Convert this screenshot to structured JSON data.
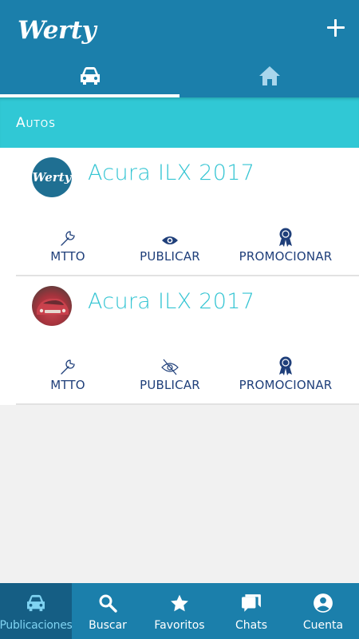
{
  "header": {
    "logo": "Werty",
    "tabs": [
      {
        "icon": "car-icon",
        "active": true
      },
      {
        "icon": "home-icon",
        "active": false
      }
    ]
  },
  "section": {
    "title": "Autos"
  },
  "cards": [
    {
      "avatar_text": "Werty",
      "title": "Acura ILX 2017",
      "actions": [
        {
          "label": "MTTO",
          "icon": "wrench-icon"
        },
        {
          "label": "PUBLICAR",
          "icon": "eye-icon"
        },
        {
          "label": "PROMOCIONAR",
          "icon": "award-ribbon-icon"
        }
      ]
    },
    {
      "avatar_text": "",
      "title": "Acura ILX 2017",
      "actions": [
        {
          "label": "MTTO",
          "icon": "wrench-icon"
        },
        {
          "label": "PUBLICAR",
          "icon": "eye-off-icon"
        },
        {
          "label": "PROMOCIONAR",
          "icon": "award-ribbon-icon"
        }
      ]
    }
  ],
  "bottom_nav": [
    {
      "label": "Publicaciones",
      "icon": "car-icon",
      "active": true
    },
    {
      "label": "Buscar",
      "icon": "search-icon",
      "active": false
    },
    {
      "label": "Favoritos",
      "icon": "star-icon",
      "active": false
    },
    {
      "label": "Chats",
      "icon": "chat-icon",
      "active": false
    },
    {
      "label": "Cuenta",
      "icon": "account-circle-icon",
      "active": false
    }
  ],
  "colors": {
    "primary": "#1b7fab",
    "primary_dark": "#155e84",
    "accent": "#30c8d5",
    "title_text": "#35c5d3",
    "action_text": "#1f3f7a",
    "active_nav_text": "#7fd3f2"
  }
}
